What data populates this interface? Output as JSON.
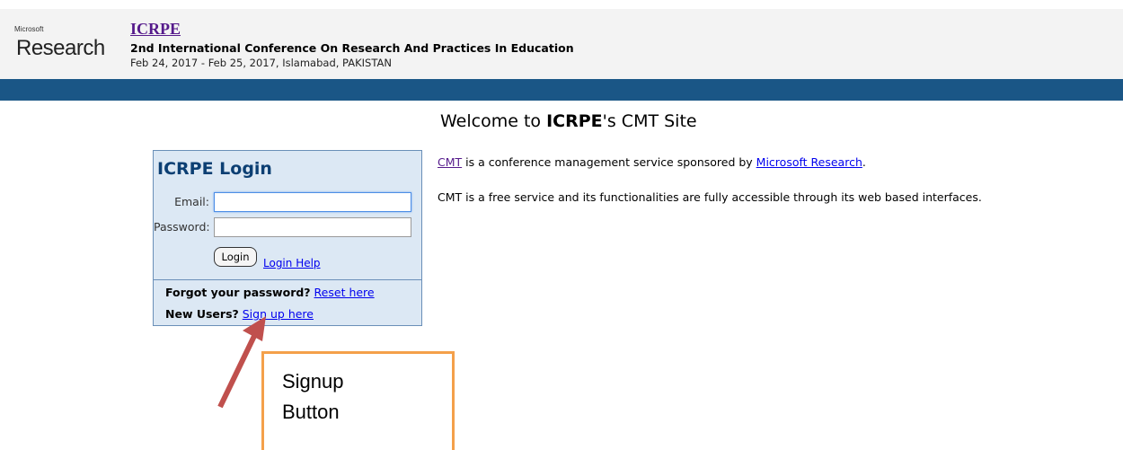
{
  "header": {
    "logo_small": "Microsoft",
    "logo_big": "Research",
    "conf_acronym": "ICRPE",
    "conf_name": "2nd International Conference On Research And Practices In Education",
    "conf_date": "Feb 24, 2017 - Feb 25, 2017, Islamabad, PAKISTAN"
  },
  "welcome": {
    "prefix": "Welcome to ",
    "name": "ICRPE",
    "suffix": "'s CMT Site"
  },
  "login": {
    "title": "ICRPE Login",
    "email_label": "Email:",
    "email_value": "",
    "password_label": "Password:",
    "password_value": "",
    "login_button": "Login",
    "login_help": "Login Help",
    "forgot_text": "Forgot your password?",
    "reset_link": "Reset here",
    "new_users_text": "New Users?",
    "signup_link": "Sign up here"
  },
  "info": {
    "cmt_link": "CMT",
    "line1_middle": " is a conference management service sponsored by ",
    "msr_link": "Microsoft Research",
    "line1_end": ".",
    "line2": "CMT is a free service and its functionalities are fully accessible through its web based interfaces."
  },
  "annotation": {
    "callout_line1": "Signup",
    "callout_line2": "Button",
    "arrow_color": "#c0504d",
    "border_color": "#f4a04a"
  },
  "colors": {
    "header_bar": "#1a5686",
    "login_bg": "#dce8f4",
    "login_title": "#0c3f73"
  }
}
